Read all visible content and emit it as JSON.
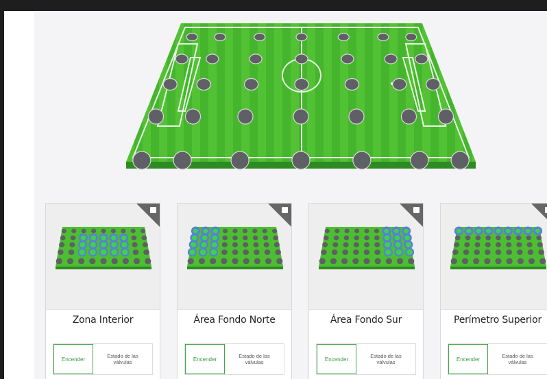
{
  "colors": {
    "accent": "#41a849",
    "field_light": "#52c234",
    "field_dark": "#3fae2a",
    "field_edge": "#2f8a22",
    "sprinkler": "#5f5f66",
    "zone_blue": "#5b7fd8",
    "corner": "#666666"
  },
  "icons": {
    "corner": "square-corner-icon",
    "sprinkler": "sprinkler-icon"
  },
  "zones": [
    {
      "title": "Zona Interior",
      "on_label": "Encender",
      "state_label": "Estado de las válvulas"
    },
    {
      "title": "Área Fondo Norte",
      "on_label": "Encender",
      "state_label": "Estado de las válvulas"
    },
    {
      "title": "Área Fondo Sur",
      "on_label": "Encender",
      "state_label": "Estado de las válvulas"
    },
    {
      "title": "Perímetro Superior",
      "on_label": "Encender",
      "state_label": "Estado de las válvulas"
    }
  ]
}
